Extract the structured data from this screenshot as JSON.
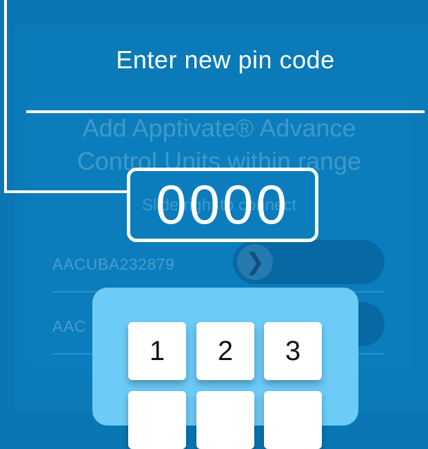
{
  "overlay": {
    "heading": "Enter new pin code",
    "pin_value": "0000"
  },
  "background_dialog": {
    "title_line1": "Add Apptivate® Advance",
    "title_line2": "Control Units within range",
    "subtitle": "Slide right to connect",
    "devices": [
      {
        "name": "AACUBA232879"
      },
      {
        "name": "AAC"
      }
    ],
    "slide_icon": "chevron-right-icon"
  },
  "keypad": {
    "keys": [
      "1",
      "2",
      "3"
    ]
  },
  "colors": {
    "background": "#0a76b4",
    "keypad": "#6ccbf7",
    "key": "#ffffff"
  }
}
